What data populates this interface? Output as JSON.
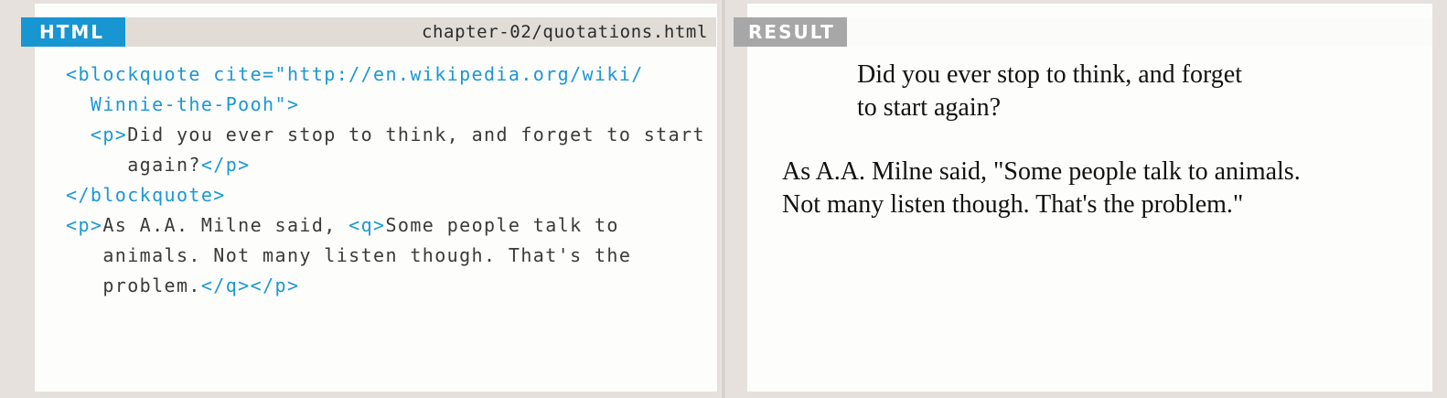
{
  "html_panel": {
    "label": "HTML",
    "file_name": "chapter-02/quotations.html",
    "code_lines": [
      [
        {
          "cls": "tag",
          "t": "<blockquote cite=\"http://en.wikipedia.org/wiki/"
        }
      ],
      [
        {
          "cls": "tag",
          "t": "  Winnie-the-Pooh\">"
        }
      ],
      [
        {
          "cls": "tag",
          "t": "  <p>"
        },
        {
          "cls": "txt",
          "t": "Did you ever stop to think, and forget to start"
        }
      ],
      [
        {
          "cls": "txt",
          "t": "     again?"
        },
        {
          "cls": "tag",
          "t": "</p>"
        }
      ],
      [
        {
          "cls": "tag",
          "t": "</blockquote>"
        }
      ],
      [
        {
          "cls": "tag",
          "t": "<p>"
        },
        {
          "cls": "txt",
          "t": "As A.A. Milne said, "
        },
        {
          "cls": "tag",
          "t": "<q>"
        },
        {
          "cls": "txt",
          "t": "Some people talk to"
        }
      ],
      [
        {
          "cls": "txt",
          "t": "   animals. Not many listen though. That's the"
        }
      ],
      [
        {
          "cls": "txt",
          "t": "   problem."
        },
        {
          "cls": "tag",
          "t": "</q></p>"
        }
      ]
    ]
  },
  "result_panel": {
    "label": "RESULT",
    "blockquote_lines": [
      "Did you ever stop to think, and forget",
      "to start again?"
    ],
    "paragraph_lines": [
      "As A.A. Milne said, \"Some people talk to animals.",
      "Not many listen though. That's the problem.\""
    ]
  },
  "colors": {
    "tag": "#1a98d5",
    "html_label_bg": "#1796d2",
    "result_label_bg": "#a7a7a7",
    "page_bg": "#e6e1dc"
  }
}
